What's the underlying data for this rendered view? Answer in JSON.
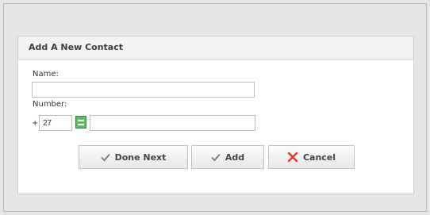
{
  "dialog": {
    "title": "Add A New Contact",
    "name_label": "Name:",
    "name_value": "",
    "number_label": "Number:",
    "plus": "+",
    "country_code": "27",
    "number_value": ""
  },
  "buttons": {
    "done_next": "Done Next",
    "add": "Add",
    "cancel": "Cancel"
  },
  "icons": {
    "check": "check-icon",
    "cancel": "x-icon",
    "country": "country-flag-icon"
  },
  "colors": {
    "cancel_icon": "#d63a2b",
    "check_icon": "#7a7a7a",
    "country_chip": "#64b86b"
  }
}
